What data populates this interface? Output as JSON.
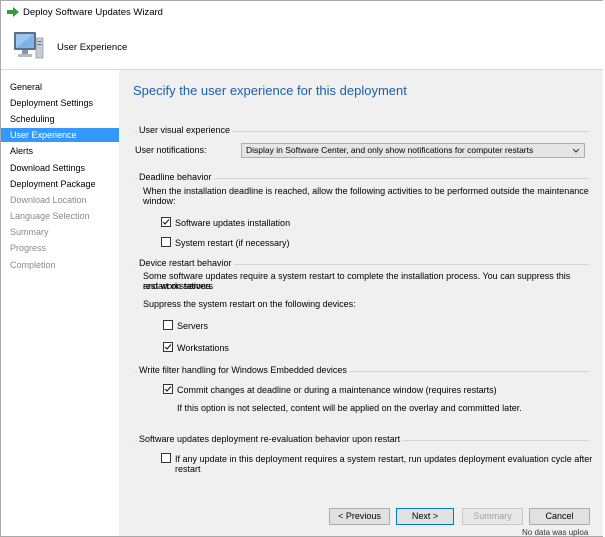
{
  "window": {
    "title": "Deploy Software Updates Wizard"
  },
  "header": {
    "title": "User Experience"
  },
  "nav": {
    "items": [
      {
        "label": "General",
        "state": "normal"
      },
      {
        "label": "Deployment Settings",
        "state": "normal"
      },
      {
        "label": "Scheduling",
        "state": "normal"
      },
      {
        "label": "User Experience",
        "state": "selected"
      },
      {
        "label": "Alerts",
        "state": "normal"
      },
      {
        "label": "Download Settings",
        "state": "normal"
      },
      {
        "label": "Deployment Package",
        "state": "normal"
      },
      {
        "label": "Download Location",
        "state": "disabled"
      },
      {
        "label": "Language Selection",
        "state": "disabled"
      },
      {
        "label": "Summary",
        "state": "disabled"
      },
      {
        "label": "Progress",
        "state": "disabled"
      },
      {
        "label": "Completion",
        "state": "disabled"
      }
    ]
  },
  "main": {
    "title": "Specify the user experience for this deployment",
    "visual": {
      "label": "User visual experience",
      "notifications_label": "User notifications:",
      "notifications_value": "Display in Software Center, and only show notifications for computer restarts"
    },
    "deadline": {
      "label": "Deadline behavior",
      "description": "When the installation deadline is reached, allow the following activities to be performed outside the maintenance window:",
      "software_updates_label": "Software updates installation",
      "software_updates_checked": true,
      "system_restart_label": "System restart (if necessary)",
      "system_restart_checked": false
    },
    "restart": {
      "label": "Device restart behavior",
      "description_line1": "Some software updates require a system restart to complete the installation process. You can suppress this restart on servers",
      "description_line2": "and workstations.",
      "suppress_label": "Suppress the system restart on the following devices:",
      "servers_label": "Servers",
      "servers_checked": false,
      "workstations_label": "Workstations",
      "workstations_checked": true
    },
    "write_filter": {
      "label": "Write filter handling for Windows Embedded devices",
      "commit_label": "Commit changes at deadline or during a maintenance window (requires restarts)",
      "commit_checked": true,
      "note": "If this option is not selected, content will be applied on the overlay and committed later."
    },
    "reeval": {
      "label": "Software updates deployment re-evaluation behavior upon restart",
      "option_label": "If any update in this deployment requires a system restart, run updates deployment evaluation cycle after restart",
      "option_checked": false
    }
  },
  "buttons": {
    "previous": "< Previous",
    "next": "Next >",
    "summary": "Summary",
    "cancel": "Cancel"
  },
  "overflow_text": "No data was uploa",
  "colors": {
    "accent": "#3399ff",
    "title_blue": "#1d5fa8",
    "arrow_green": "#2e9d3a"
  }
}
